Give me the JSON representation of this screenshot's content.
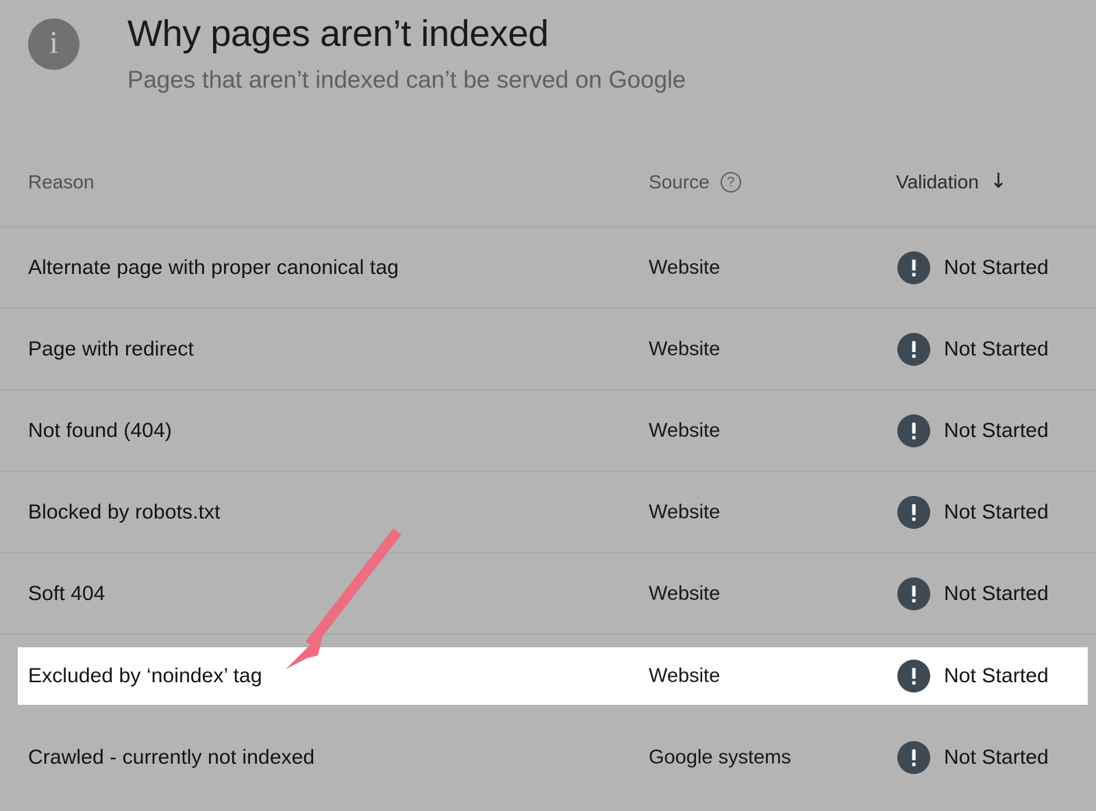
{
  "header": {
    "icon": "info-icon",
    "title": "Why pages aren’t indexed",
    "subtitle": "Pages that aren’t indexed can’t be served on Google"
  },
  "table": {
    "columns": [
      {
        "key": "reason",
        "label": "Reason"
      },
      {
        "key": "source",
        "label": "Source",
        "icon": "help-circle-icon"
      },
      {
        "key": "validation",
        "label": "Validation",
        "sort_icon": "arrow-down-icon",
        "sorted": "descending"
      }
    ],
    "rows": [
      {
        "reason": "Alternate page with proper canonical tag",
        "source": "Website",
        "validation": "Not Started",
        "status_icon": "alert-exclamation-icon",
        "highlighted": false
      },
      {
        "reason": "Page with redirect",
        "source": "Website",
        "validation": "Not Started",
        "status_icon": "alert-exclamation-icon",
        "highlighted": false
      },
      {
        "reason": "Not found (404)",
        "source": "Website",
        "validation": "Not Started",
        "status_icon": "alert-exclamation-icon",
        "highlighted": false
      },
      {
        "reason": "Blocked by robots.txt",
        "source": "Website",
        "validation": "Not Started",
        "status_icon": "alert-exclamation-icon",
        "highlighted": false
      },
      {
        "reason": "Soft 404",
        "source": "Website",
        "validation": "Not Started",
        "status_icon": "alert-exclamation-icon",
        "highlighted": false
      },
      {
        "reason": "Excluded by ‘noindex’ tag",
        "source": "Website",
        "validation": "Not Started",
        "status_icon": "alert-exclamation-icon",
        "highlighted": true
      },
      {
        "reason": "Crawled - currently not indexed",
        "source": "Google systems",
        "validation": "Not Started",
        "status_icon": "alert-exclamation-icon",
        "highlighted": false
      }
    ]
  },
  "annotation": {
    "type": "arrow",
    "color": "#ee6d81",
    "points_to": "Excluded by ‘noindex’ tag"
  },
  "colors": {
    "background": "#b4b4b4",
    "highlight_row": "#ffffff",
    "status_icon": "#3d4a54",
    "divider": "#a8a8a8",
    "arrow": "#ee6d81"
  }
}
